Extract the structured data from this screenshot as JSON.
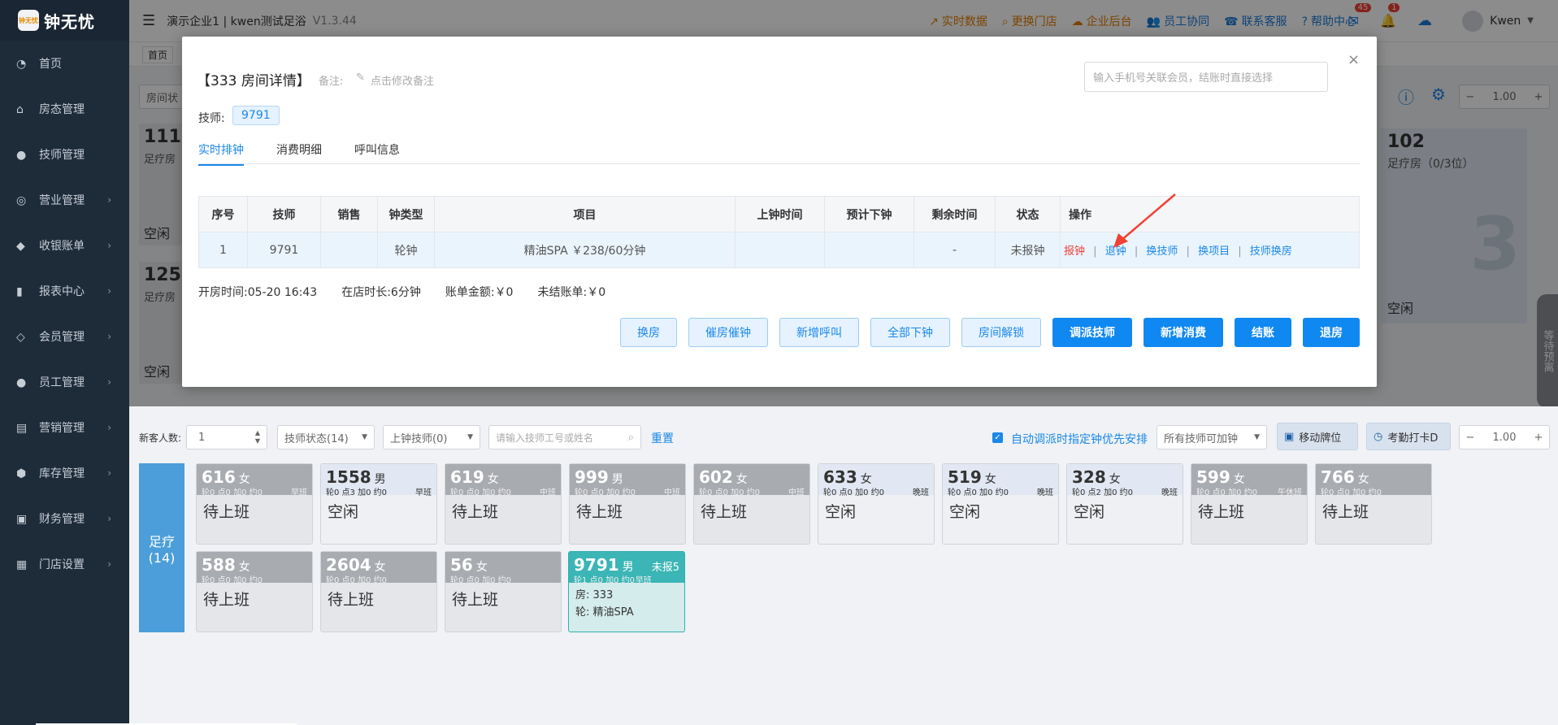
{
  "app": {
    "logo_badge": "钟无忧",
    "logo_text": "钟无忧"
  },
  "sidebar": {
    "items": [
      {
        "label": "首页",
        "icon": "dashboard-icon",
        "chev": false
      },
      {
        "label": "房态管理",
        "icon": "home-icon",
        "chev": false
      },
      {
        "label": "技师管理",
        "icon": "user-icon",
        "chev": false
      },
      {
        "label": "营业管理",
        "icon": "business-icon",
        "chev": true
      },
      {
        "label": "收银账单",
        "icon": "cashier-icon",
        "chev": true
      },
      {
        "label": "报表中心",
        "icon": "chart-icon",
        "chev": true
      },
      {
        "label": "会员管理",
        "icon": "diamond-icon",
        "chev": true
      },
      {
        "label": "员工管理",
        "icon": "staff-icon",
        "chev": true
      },
      {
        "label": "营销管理",
        "icon": "briefcase-icon",
        "chev": true
      },
      {
        "label": "库存管理",
        "icon": "box-icon",
        "chev": true
      },
      {
        "label": "财务管理",
        "icon": "finance-icon",
        "chev": true
      },
      {
        "label": "门店设置",
        "icon": "grid-icon",
        "chev": true
      }
    ]
  },
  "topbar": {
    "company": "演示企业1 | kwen测试足浴",
    "version": "V1.3.44",
    "links": [
      "实时数据",
      "更换门店",
      "企业后台",
      "员工协同",
      "联系客服",
      "帮助中心"
    ],
    "mail_badge": "45",
    "bell_badge": "1",
    "user": "Kwen",
    "home_tab": "首页"
  },
  "background": {
    "room_filter_label": "房间状",
    "zoom": "1.00",
    "room_left_top": {
      "num": "111",
      "type": "足疗房",
      "status": "空闲"
    },
    "room_left_bottom": {
      "num": "125",
      "type": "足疗房",
      "status": "空闲"
    },
    "room_right": {
      "num": "102",
      "type": "足疗房（0/3位）",
      "status": "空闲",
      "big": "3"
    },
    "waiting_panel": "等待预离"
  },
  "modal": {
    "title": "【333 房间详情】",
    "remark_label": "备注:",
    "remark_action": "点击修改备注",
    "member_placeholder": "输入手机号关联会员，结账时直接选择",
    "tech_label": "技师:",
    "tech_tag": "9791",
    "tabs": [
      "实时排钟",
      "消费明细",
      "呼叫信息"
    ],
    "table": {
      "headers": [
        "序号",
        "技师",
        "销售",
        "钟类型",
        "项目",
        "上钟时间",
        "预计下钟",
        "剩余时间",
        "状态",
        "操作"
      ],
      "rows": [
        {
          "idx": "1",
          "tech": "9791",
          "sales": "",
          "type": "轮钟",
          "item": "精油SPA ￥238/60分钟",
          "start": "",
          "end": "",
          "remain": "-",
          "status": "未报钟",
          "ops": [
            "报钟",
            "退钟",
            "换技师",
            "换项目",
            "技师换房"
          ]
        }
      ]
    },
    "footer": {
      "open_time_label": "开房时间:",
      "open_time": "05-20 16:43",
      "stay_label": "在店时长:",
      "stay": "6分钟",
      "amount_label": "账单金额:",
      "amount": "￥0",
      "unpaid_label": "未结账单:",
      "unpaid": "￥0"
    },
    "buttons_light": [
      "换房",
      "催房催钟",
      "新增呼叫",
      "全部下钟",
      "房间解锁"
    ],
    "buttons_blue": [
      "调派技师",
      "新增消费",
      "结账",
      "退房"
    ]
  },
  "controls": {
    "new_guests_label": "新客人数:",
    "new_guests_value": "1",
    "tech_status": "技师状态(14)",
    "on_tech": "上钟技师(0)",
    "search_placeholder": "请输入技师工号或姓名",
    "reset": "重置",
    "auto_label": "自动调派时指定钟优先安排",
    "all_tech": "所有技师可加钟",
    "move_board": "移动牌位",
    "attendance": "考勤打卡D",
    "zoom": "1.00"
  },
  "tech_panel": {
    "category": "足疗",
    "count": "(14)",
    "techs": [
      {
        "num": "616",
        "sex": "女",
        "meta": "轮0 点0 加0 约0",
        "shift": "早班",
        "status": "待上班",
        "idle": false
      },
      {
        "num": "1558",
        "sex": "男",
        "meta": "轮0 点3 加0 约0",
        "shift": "早班",
        "status": "空闲",
        "idle": true
      },
      {
        "num": "619",
        "sex": "女",
        "meta": "轮0 点0 加0 约0",
        "shift": "中班",
        "status": "待上班",
        "idle": false
      },
      {
        "num": "999",
        "sex": "男",
        "meta": "轮0 点0 加0 约0",
        "shift": "中班",
        "status": "待上班",
        "idle": false
      },
      {
        "num": "602",
        "sex": "女",
        "meta": "轮0 点0 加0 约0",
        "shift": "中班",
        "status": "待上班",
        "idle": false
      },
      {
        "num": "633",
        "sex": "女",
        "meta": "轮0 点0 加0 约0",
        "shift": "晚班",
        "status": "空闲",
        "idle": true
      },
      {
        "num": "519",
        "sex": "女",
        "meta": "轮0 点0 加0 约0",
        "shift": "晚班",
        "status": "空闲",
        "idle": true
      },
      {
        "num": "328",
        "sex": "女",
        "meta": "轮0 点2 加0 约0",
        "shift": "晚班",
        "status": "空闲",
        "idle": true
      },
      {
        "num": "599",
        "sex": "女",
        "meta": "轮0 点0 加0 约0",
        "shift": "午休班",
        "status": "待上班",
        "idle": false
      },
      {
        "num": "766",
        "sex": "女",
        "meta": "轮0 点0 加0 约0",
        "shift": "",
        "status": "待上班",
        "idle": false
      },
      {
        "num": "588",
        "sex": "女",
        "meta": "轮0 点0 加0 约0",
        "shift": "",
        "status": "待上班",
        "idle": false
      },
      {
        "num": "2604",
        "sex": "女",
        "meta": "轮0 点0 加0 约0",
        "shift": "",
        "status": "待上班",
        "idle": false
      },
      {
        "num": "56",
        "sex": "女",
        "meta": "轮0 点0 加0 约0",
        "shift": "",
        "status": "待上班",
        "idle": false
      }
    ],
    "active_tech": {
      "num": "9791",
      "sex": "男",
      "badge": "未报5",
      "meta": "轮1 点0 加0 约0",
      "shift": "早班",
      "room": "房: 333",
      "item": "轮: 精油SPA"
    }
  }
}
